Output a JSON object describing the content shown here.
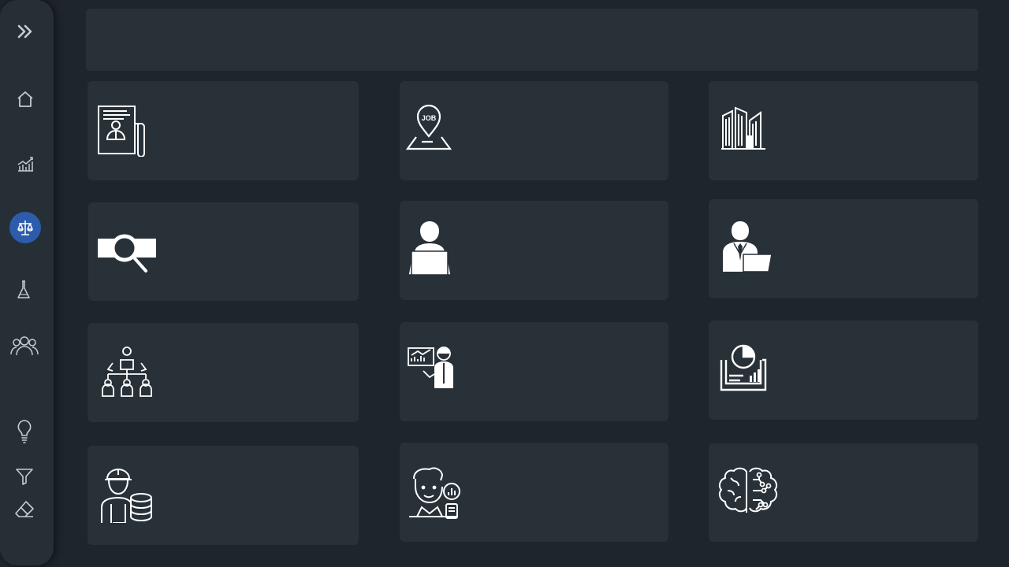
{
  "sidebar": {
    "items": [
      {
        "id": "expand",
        "icon": "double-chevron-right-icon"
      },
      {
        "id": "home",
        "icon": "home-icon"
      },
      {
        "id": "analytics",
        "icon": "bar-chart-trend-icon"
      },
      {
        "id": "legal",
        "icon": "scales-icon",
        "active": true
      },
      {
        "id": "lab",
        "icon": "flask-icon"
      },
      {
        "id": "people",
        "icon": "group-icon"
      },
      {
        "id": "ideas",
        "icon": "lightbulb-icon"
      },
      {
        "id": "filter",
        "icon": "filter-icon"
      },
      {
        "id": "clear",
        "icon": "eraser-icon"
      }
    ],
    "active_color": "#2c5cab"
  },
  "search": {
    "value": ""
  },
  "cards": [
    {
      "id": "resume",
      "icon": "resume-document-icon"
    },
    {
      "id": "job-location",
      "icon": "job-location-pin-icon",
      "icon_text": "JOB"
    },
    {
      "id": "company",
      "icon": "office-buildings-icon"
    },
    {
      "id": "search",
      "icon": "magnifier-search-icon"
    },
    {
      "id": "candidate",
      "icon": "person-laptop-icon"
    },
    {
      "id": "professional",
      "icon": "businessman-laptop-icon"
    },
    {
      "id": "org-structure",
      "icon": "organization-chart-icon"
    },
    {
      "id": "presentation",
      "icon": "presenter-chart-icon"
    },
    {
      "id": "report",
      "icon": "report-pie-chart-icon"
    },
    {
      "id": "data-engineer",
      "icon": "engineer-database-icon"
    },
    {
      "id": "analyst",
      "icon": "analyst-person-icon"
    },
    {
      "id": "ai-brain",
      "icon": "ai-brain-circuit-icon"
    }
  ],
  "colors": {
    "background": "#1e252c",
    "panel": "#283138",
    "sidebar": "#272f36",
    "icon": "#ffffff",
    "sidebar_icon": "#c5ccd2"
  }
}
